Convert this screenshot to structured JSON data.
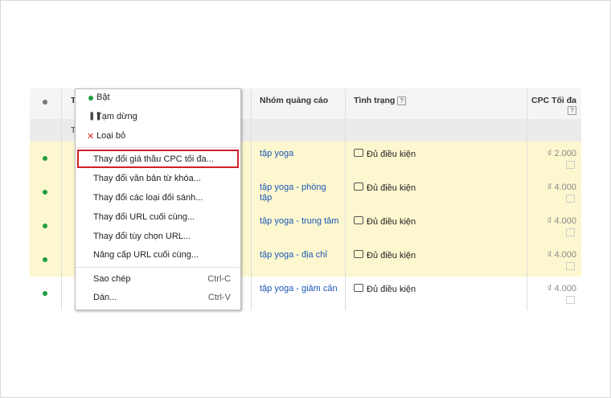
{
  "table": {
    "headers": {
      "group": "Nhóm quảng cáo",
      "status": "Tình trạng",
      "cpc": "CPC Tối đa",
      "help": "?"
    },
    "hidden_col_initial": "T",
    "rows": [
      {
        "group": "tập yoga",
        "status": "Đủ điều kiện",
        "cpc": "₫ 2.000"
      },
      {
        "group": "tập yoga - phòng tập",
        "status": "Đủ điều kiện",
        "cpc": "₫ 4.000"
      },
      {
        "group": "tập yoga - trung tâm",
        "status": "Đủ điều kiện",
        "cpc": "₫ 4.000"
      },
      {
        "group": "tập yoga - địa chỉ",
        "status": "Đủ điều kiện",
        "cpc": "₫ 4.000"
      },
      {
        "group": "tập yoga - giảm cân",
        "status": "Đủ điều kiện",
        "cpc": "₫ 4.000"
      }
    ]
  },
  "menu": {
    "status_items": [
      {
        "label": "Bật",
        "icon": "green-dot-icon"
      },
      {
        "label": "Tạm dừng",
        "icon": "pause-icon"
      },
      {
        "label": "Loại bỏ",
        "icon": "remove-x-icon"
      }
    ],
    "edit_items": [
      "Thay đổi giá thầu CPC tối đa...",
      "Thay đổi văn bản từ khóa...",
      "Thay đổi các loại đối sánh...",
      "Thay đổi URL cuối cùng...",
      "Thay đổi tùy chọn URL...",
      "Nâng cấp URL cuối cùng..."
    ],
    "clipboard_items": [
      {
        "label": "Sao chép",
        "shortcut": "Ctrl-C"
      },
      {
        "label": "Dán...",
        "shortcut": "Ctrl-V"
      }
    ]
  },
  "colors": {
    "highlight_border": "#d0202a",
    "row_yellow": "#fdf7cf",
    "link": "#1a57b5",
    "status_green": "#1e9e3e"
  }
}
